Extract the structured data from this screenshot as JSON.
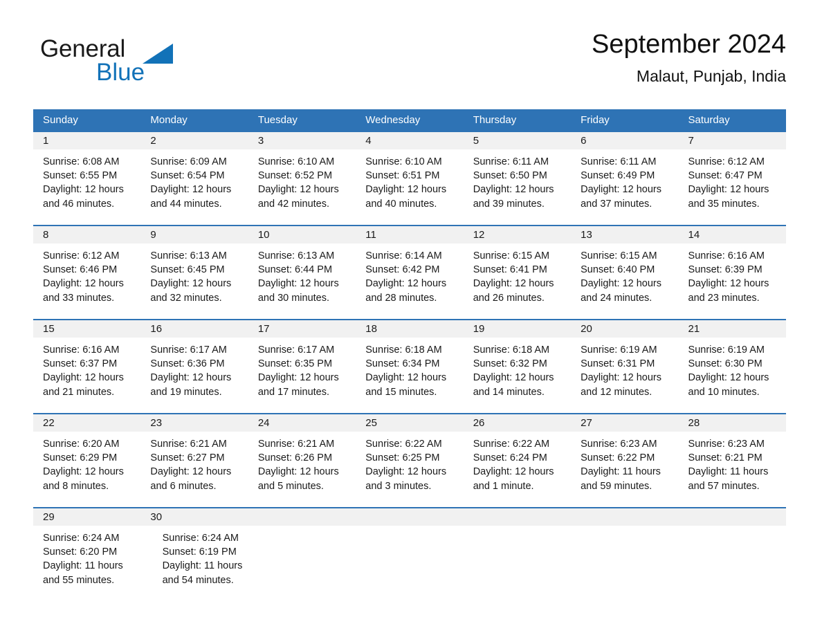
{
  "brand": {
    "name_part1": "General",
    "name_part2": "Blue",
    "triangle_color": "#1272b8"
  },
  "header": {
    "title": "September 2024",
    "subtitle": "Malaut, Punjab, India"
  },
  "theme": {
    "header_blue": "#2e73b5",
    "daynum_band": "#f1f1f1",
    "text": "#1a1a1a"
  },
  "weekdays": [
    "Sunday",
    "Monday",
    "Tuesday",
    "Wednesday",
    "Thursday",
    "Friday",
    "Saturday"
  ],
  "weeks": [
    {
      "days": [
        {
          "num": "1",
          "sunrise": "Sunrise: 6:08 AM",
          "sunset": "Sunset: 6:55 PM",
          "daylight1": "Daylight: 12 hours",
          "daylight2": "and 46 minutes."
        },
        {
          "num": "2",
          "sunrise": "Sunrise: 6:09 AM",
          "sunset": "Sunset: 6:54 PM",
          "daylight1": "Daylight: 12 hours",
          "daylight2": "and 44 minutes."
        },
        {
          "num": "3",
          "sunrise": "Sunrise: 6:10 AM",
          "sunset": "Sunset: 6:52 PM",
          "daylight1": "Daylight: 12 hours",
          "daylight2": "and 42 minutes."
        },
        {
          "num": "4",
          "sunrise": "Sunrise: 6:10 AM",
          "sunset": "Sunset: 6:51 PM",
          "daylight1": "Daylight: 12 hours",
          "daylight2": "and 40 minutes."
        },
        {
          "num": "5",
          "sunrise": "Sunrise: 6:11 AM",
          "sunset": "Sunset: 6:50 PM",
          "daylight1": "Daylight: 12 hours",
          "daylight2": "and 39 minutes."
        },
        {
          "num": "6",
          "sunrise": "Sunrise: 6:11 AM",
          "sunset": "Sunset: 6:49 PM",
          "daylight1": "Daylight: 12 hours",
          "daylight2": "and 37 minutes."
        },
        {
          "num": "7",
          "sunrise": "Sunrise: 6:12 AM",
          "sunset": "Sunset: 6:47 PM",
          "daylight1": "Daylight: 12 hours",
          "daylight2": "and 35 minutes."
        }
      ]
    },
    {
      "days": [
        {
          "num": "8",
          "sunrise": "Sunrise: 6:12 AM",
          "sunset": "Sunset: 6:46 PM",
          "daylight1": "Daylight: 12 hours",
          "daylight2": "and 33 minutes."
        },
        {
          "num": "9",
          "sunrise": "Sunrise: 6:13 AM",
          "sunset": "Sunset: 6:45 PM",
          "daylight1": "Daylight: 12 hours",
          "daylight2": "and 32 minutes."
        },
        {
          "num": "10",
          "sunrise": "Sunrise: 6:13 AM",
          "sunset": "Sunset: 6:44 PM",
          "daylight1": "Daylight: 12 hours",
          "daylight2": "and 30 minutes."
        },
        {
          "num": "11",
          "sunrise": "Sunrise: 6:14 AM",
          "sunset": "Sunset: 6:42 PM",
          "daylight1": "Daylight: 12 hours",
          "daylight2": "and 28 minutes."
        },
        {
          "num": "12",
          "sunrise": "Sunrise: 6:15 AM",
          "sunset": "Sunset: 6:41 PM",
          "daylight1": "Daylight: 12 hours",
          "daylight2": "and 26 minutes."
        },
        {
          "num": "13",
          "sunrise": "Sunrise: 6:15 AM",
          "sunset": "Sunset: 6:40 PM",
          "daylight1": "Daylight: 12 hours",
          "daylight2": "and 24 minutes."
        },
        {
          "num": "14",
          "sunrise": "Sunrise: 6:16 AM",
          "sunset": "Sunset: 6:39 PM",
          "daylight1": "Daylight: 12 hours",
          "daylight2": "and 23 minutes."
        }
      ]
    },
    {
      "days": [
        {
          "num": "15",
          "sunrise": "Sunrise: 6:16 AM",
          "sunset": "Sunset: 6:37 PM",
          "daylight1": "Daylight: 12 hours",
          "daylight2": "and 21 minutes."
        },
        {
          "num": "16",
          "sunrise": "Sunrise: 6:17 AM",
          "sunset": "Sunset: 6:36 PM",
          "daylight1": "Daylight: 12 hours",
          "daylight2": "and 19 minutes."
        },
        {
          "num": "17",
          "sunrise": "Sunrise: 6:17 AM",
          "sunset": "Sunset: 6:35 PM",
          "daylight1": "Daylight: 12 hours",
          "daylight2": "and 17 minutes."
        },
        {
          "num": "18",
          "sunrise": "Sunrise: 6:18 AM",
          "sunset": "Sunset: 6:34 PM",
          "daylight1": "Daylight: 12 hours",
          "daylight2": "and 15 minutes."
        },
        {
          "num": "19",
          "sunrise": "Sunrise: 6:18 AM",
          "sunset": "Sunset: 6:32 PM",
          "daylight1": "Daylight: 12 hours",
          "daylight2": "and 14 minutes."
        },
        {
          "num": "20",
          "sunrise": "Sunrise: 6:19 AM",
          "sunset": "Sunset: 6:31 PM",
          "daylight1": "Daylight: 12 hours",
          "daylight2": "and 12 minutes."
        },
        {
          "num": "21",
          "sunrise": "Sunrise: 6:19 AM",
          "sunset": "Sunset: 6:30 PM",
          "daylight1": "Daylight: 12 hours",
          "daylight2": "and 10 minutes."
        }
      ]
    },
    {
      "days": [
        {
          "num": "22",
          "sunrise": "Sunrise: 6:20 AM",
          "sunset": "Sunset: 6:29 PM",
          "daylight1": "Daylight: 12 hours",
          "daylight2": "and 8 minutes."
        },
        {
          "num": "23",
          "sunrise": "Sunrise: 6:21 AM",
          "sunset": "Sunset: 6:27 PM",
          "daylight1": "Daylight: 12 hours",
          "daylight2": "and 6 minutes."
        },
        {
          "num": "24",
          "sunrise": "Sunrise: 6:21 AM",
          "sunset": "Sunset: 6:26 PM",
          "daylight1": "Daylight: 12 hours",
          "daylight2": "and 5 minutes."
        },
        {
          "num": "25",
          "sunrise": "Sunrise: 6:22 AM",
          "sunset": "Sunset: 6:25 PM",
          "daylight1": "Daylight: 12 hours",
          "daylight2": "and 3 minutes."
        },
        {
          "num": "26",
          "sunrise": "Sunrise: 6:22 AM",
          "sunset": "Sunset: 6:24 PM",
          "daylight1": "Daylight: 12 hours",
          "daylight2": "and 1 minute."
        },
        {
          "num": "27",
          "sunrise": "Sunrise: 6:23 AM",
          "sunset": "Sunset: 6:22 PM",
          "daylight1": "Daylight: 11 hours",
          "daylight2": "and 59 minutes."
        },
        {
          "num": "28",
          "sunrise": "Sunrise: 6:23 AM",
          "sunset": "Sunset: 6:21 PM",
          "daylight1": "Daylight: 11 hours",
          "daylight2": "and 57 minutes."
        }
      ]
    },
    {
      "days": [
        {
          "num": "29",
          "sunrise": "Sunrise: 6:24 AM",
          "sunset": "Sunset: 6:20 PM",
          "daylight1": "Daylight: 11 hours",
          "daylight2": "and 55 minutes."
        },
        {
          "num": "30",
          "sunrise": "Sunrise: 6:24 AM",
          "sunset": "Sunset: 6:19 PM",
          "daylight1": "Daylight: 11 hours",
          "daylight2": "and 54 minutes."
        }
      ]
    }
  ]
}
